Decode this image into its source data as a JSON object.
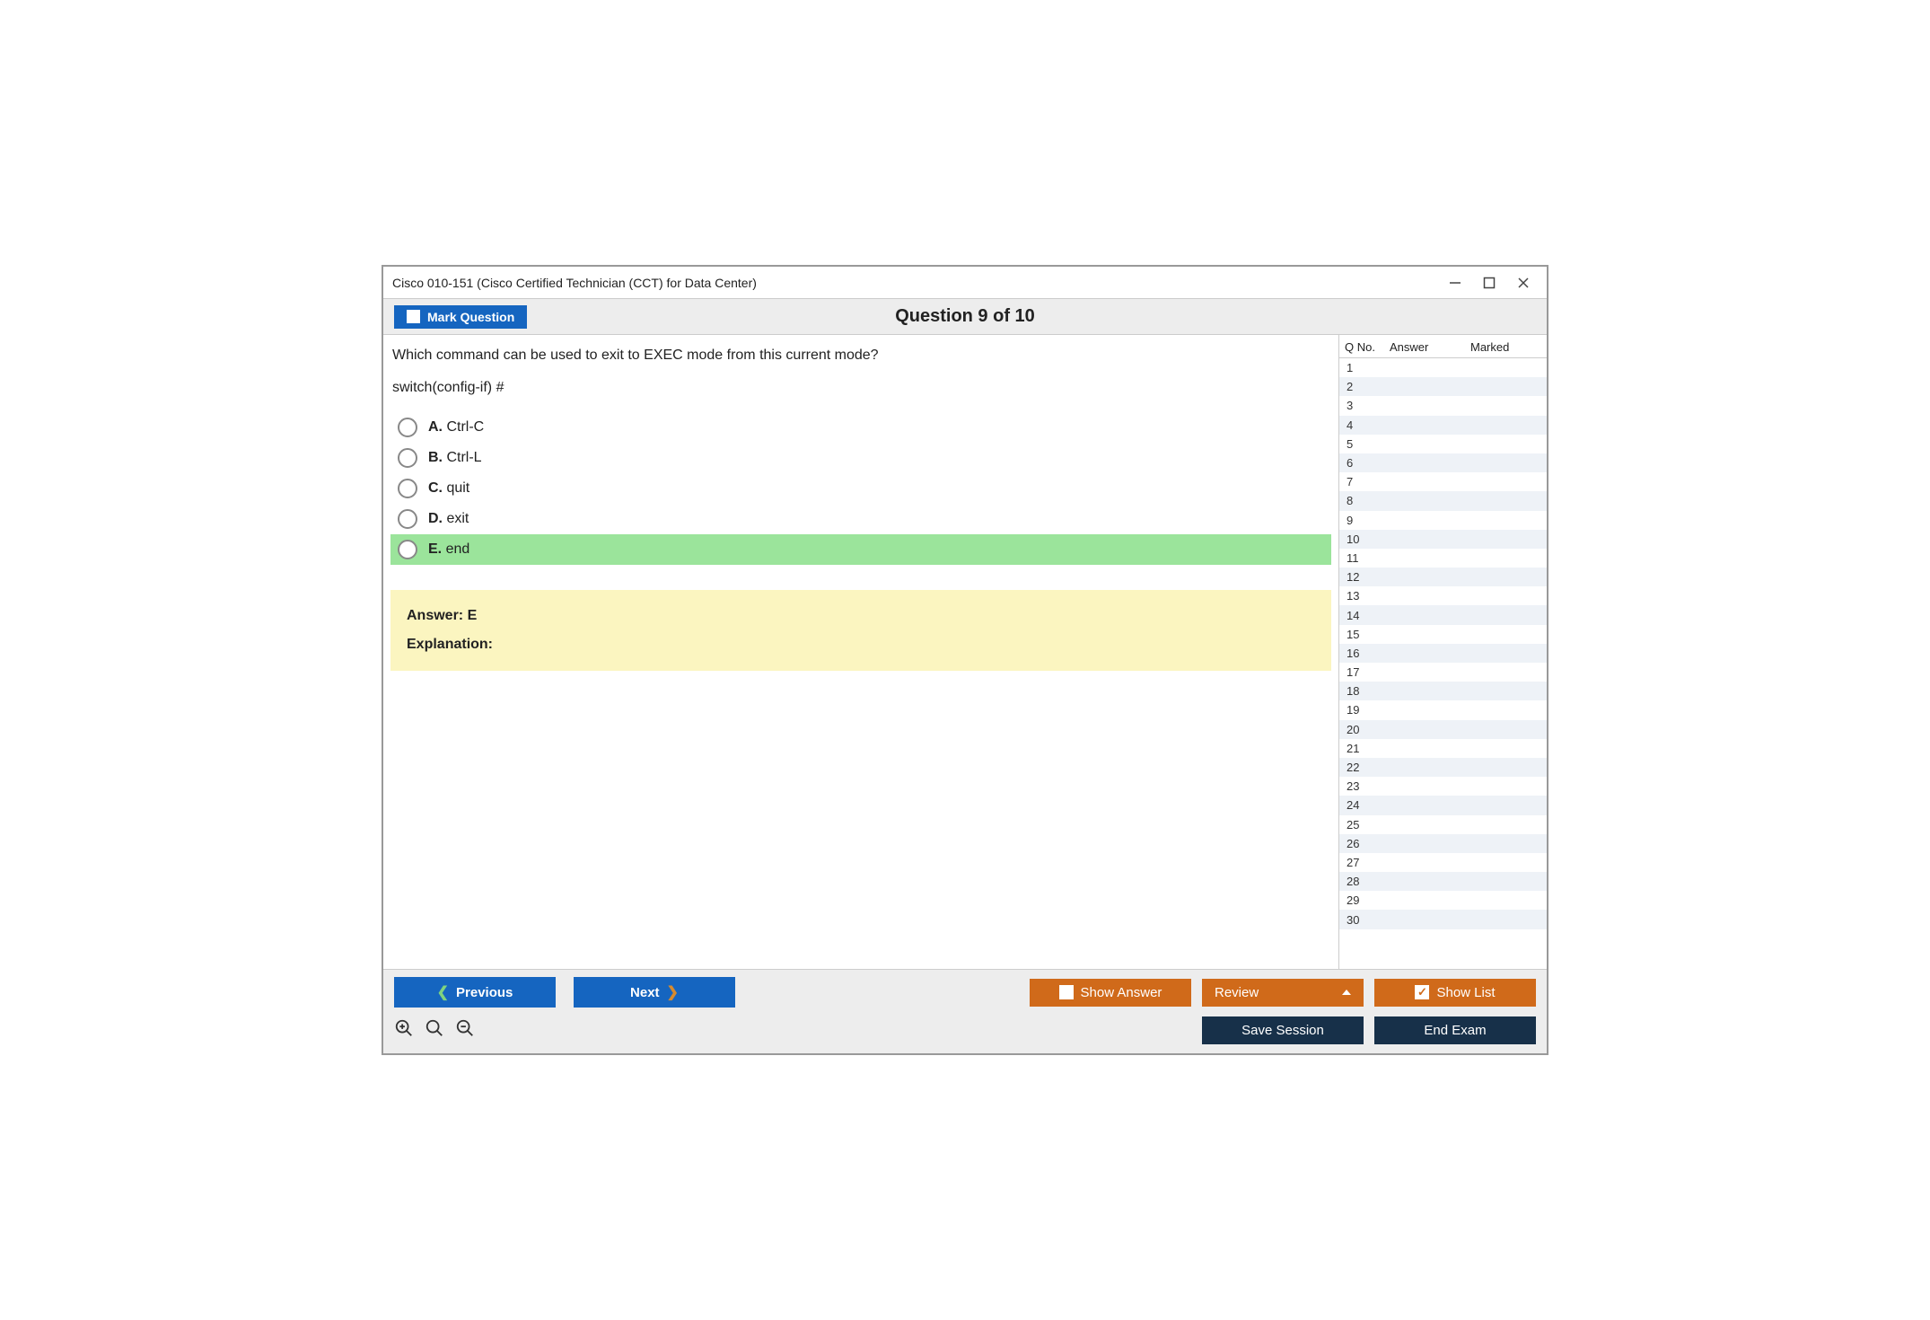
{
  "window": {
    "title": "Cisco 010-151 (Cisco Certified Technician (CCT) for Data Center)"
  },
  "header": {
    "mark_label": "Mark Question",
    "counter": "Question 9 of 10"
  },
  "question": {
    "text": "Which command can be used to exit to EXEC mode from this current mode?",
    "prompt": "switch(config-if) #",
    "options": [
      {
        "letter": "A.",
        "text": "Ctrl-C",
        "correct": false
      },
      {
        "letter": "B.",
        "text": "Ctrl-L",
        "correct": false
      },
      {
        "letter": "C.",
        "text": "quit",
        "correct": false
      },
      {
        "letter": "D.",
        "text": "exit",
        "correct": false
      },
      {
        "letter": "E.",
        "text": "end",
        "correct": true
      }
    ]
  },
  "answer_box": {
    "answer": "Answer: E",
    "explanation": "Explanation:"
  },
  "sidebar": {
    "headers": {
      "qno": "Q No.",
      "answer": "Answer",
      "marked": "Marked"
    },
    "rows": [
      1,
      2,
      3,
      4,
      5,
      6,
      7,
      8,
      9,
      10,
      11,
      12,
      13,
      14,
      15,
      16,
      17,
      18,
      19,
      20,
      21,
      22,
      23,
      24,
      25,
      26,
      27,
      28,
      29,
      30
    ]
  },
  "footer": {
    "previous": "Previous",
    "next": "Next",
    "show_answer": "Show Answer",
    "review": "Review",
    "show_list": "Show List",
    "save_session": "Save Session",
    "end_exam": "End Exam"
  }
}
